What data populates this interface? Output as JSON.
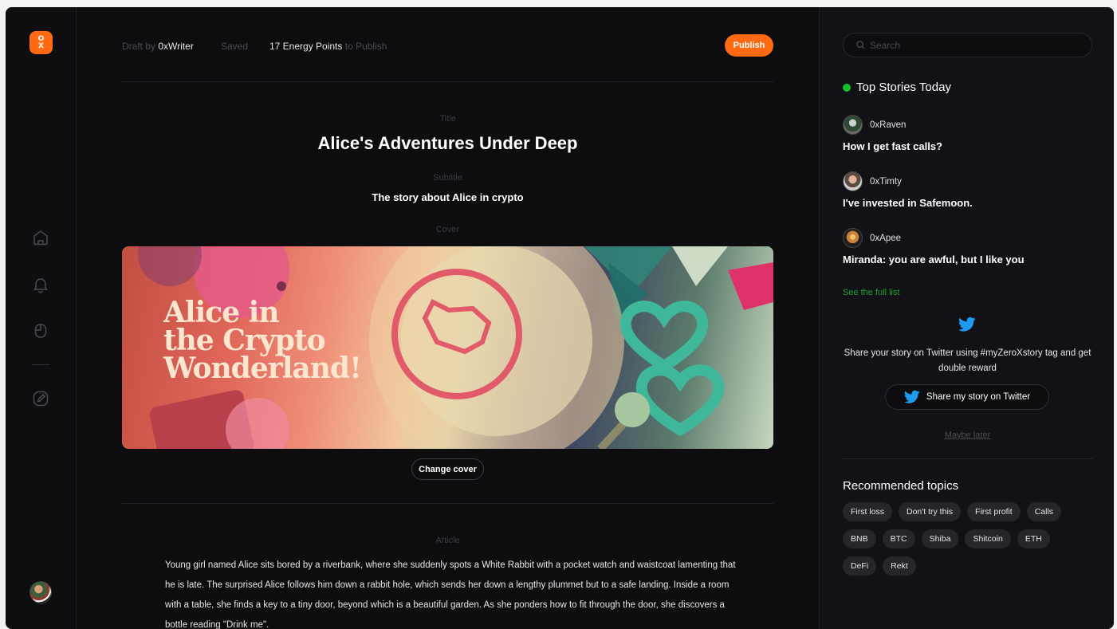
{
  "logo": {
    "line1": "O",
    "line2": "X"
  },
  "topbar": {
    "draft_prefix": "Draft by",
    "author": "0xWriter",
    "saved": "Saved",
    "energy_points": "17 Energy Points",
    "energy_suffix": "to Publish",
    "publish_label": "Publish"
  },
  "editor": {
    "title_label": "Title",
    "title": "Alice's Adventures Under Deep",
    "subtitle_label": "Subtitle",
    "subtitle": "The story about Alice in crypto",
    "cover_label": "Cover",
    "cover_text": "Alice in\nthe Crypto\nWonderland!",
    "change_cover_label": "Change cover",
    "article_label": "Article",
    "article_text": "Young girl named Alice sits bored by a riverbank, where she suddenly spots a White Rabbit with a pocket watch and waistcoat lamenting that he is late. The surprised Alice follows him down a rabbit hole, which sends her down a lengthy plummet but to a safe landing. Inside a room with a table, she finds a key to a tiny door, beyond which is a beautiful garden. As she ponders how to fit through the door, she discovers a bottle reading \"Drink me\"."
  },
  "sidebar": {
    "search_placeholder": "Search",
    "top_stories_title": "Top Stories Today",
    "stories": [
      {
        "author": "0xRaven",
        "title": "How I get fast calls?"
      },
      {
        "author": "0xTimty",
        "title": "I've invested in Safemoon."
      },
      {
        "author": "0xApee",
        "title": "Miranda: you are awful, but I like you"
      }
    ],
    "see_full_list": "See the full list",
    "share_text": "Share your story on Twitter using #myZeroXstory tag and get double reward",
    "share_button": "Share my story on Twitter",
    "maybe_later": "Maybe later",
    "recommended_title": "Recommended topics",
    "topics": [
      "First loss",
      "Don't try this",
      "First profit",
      "Calls",
      "BNB",
      "BTC",
      "Shiba",
      "Shitcoin",
      "ETH",
      "DeFi",
      "Rekt"
    ]
  },
  "colors": {
    "accent": "#ff6a13",
    "live_green": "#16c12b",
    "link_green": "#19a22e",
    "twitter_blue": "#1d9bf0"
  }
}
